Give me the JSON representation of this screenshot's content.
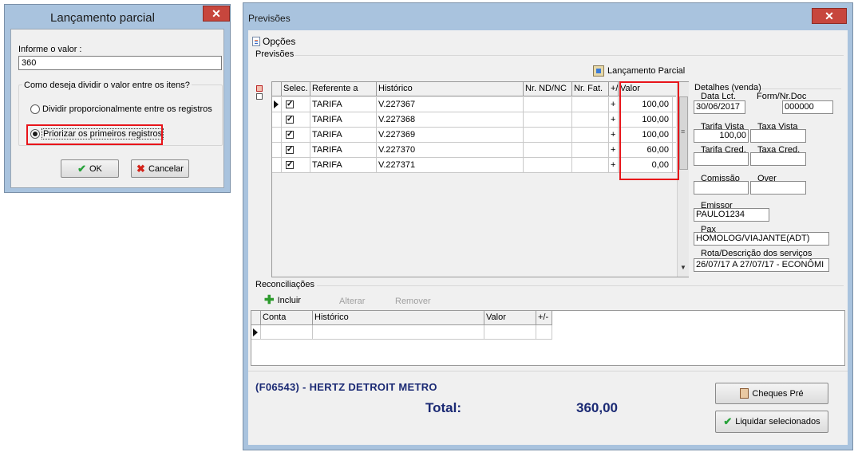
{
  "dialog_partial": {
    "title": "Lançamento parcial",
    "close_glyph": "✕",
    "prompt_label": "Informe o valor :",
    "value": "360",
    "group_label": "Como deseja dividir o valor entre os itens?",
    "option1": "Dividir proporcionalmente entre os registros",
    "option2": "Priorizar os primeiros registros",
    "selected_option": "option2",
    "ok_label": "OK",
    "cancel_label": "Cancelar"
  },
  "window": {
    "title": "Previsões",
    "close_glyph": "✕",
    "opcoes_label": "Opções",
    "previsoes_label": "Previsões",
    "lancamento_parcial_label": "Lançamento Parcial"
  },
  "grid": {
    "headers": {
      "selec": "Selec.",
      "referente": "Referente a",
      "historico": "Histórico",
      "nr_nd": "Nr. ND/NC",
      "nr_fat": "Nr. Fat.",
      "sign": "+/-",
      "valor": "Valor"
    },
    "rows": [
      {
        "checked": "✓",
        "referente": "TARIFA",
        "historico": "V.227367",
        "sign": "+",
        "valor": "100,00"
      },
      {
        "checked": "✓",
        "referente": "TARIFA",
        "historico": "V.227368",
        "sign": "+",
        "valor": "100,00"
      },
      {
        "checked": "✓",
        "referente": "TARIFA",
        "historico": "V.227369",
        "sign": "+",
        "valor": "100,00"
      },
      {
        "checked": "✓",
        "referente": "TARIFA",
        "historico": "V.227370",
        "sign": "+",
        "valor": "60,00"
      },
      {
        "checked": "✓",
        "referente": "TARIFA",
        "historico": "V.227371",
        "sign": "+",
        "valor": "0,00"
      }
    ]
  },
  "details": {
    "section_label": "Detalhes (venda)",
    "data_lct_label": "Data Lct.",
    "data_lct": "30/06/2017",
    "form_nr_doc_label": "Form/Nr.Doc",
    "form_nr_doc": "000000",
    "tarifa_vista_label": "Tarifa Vista",
    "tarifa_vista": "100,00",
    "taxa_vista_label": "Taxa Vista",
    "taxa_vista": "",
    "tarifa_cred_label": "Tarifa Cred.",
    "tarifa_cred": "",
    "taxa_cred_label": "Taxa Cred.",
    "taxa_cred": "",
    "comissao_label": "Comissão",
    "comissao": "",
    "over_label": "Over",
    "over": "",
    "emissor_label": "Emissor",
    "emissor": "PAULO1234",
    "pax_label": "Pax",
    "pax": "HOMOLOG/VIAJANTE(ADT)",
    "rota_label": "Rota/Descrição dos serviços",
    "rota": "26/07/17 A 27/07/17 - ECONÔMI"
  },
  "reconciliacoes": {
    "label": "Reconciliações",
    "incluir": "Incluir",
    "alterar": "Alterar",
    "remover": "Remover",
    "headers": {
      "conta": "Conta",
      "historico": "Histórico",
      "valor": "Valor",
      "sign": "+/-"
    }
  },
  "footer": {
    "company": "(F06543) - HERTZ DETROIT METRO",
    "total_label": "Total:",
    "total_value": "360,00",
    "cheques_label": "Cheques Pré",
    "liquidar_label": "Liquidar selecionados"
  },
  "colors": {
    "highlight": "#e8141a",
    "titlebar": "#a9c3de",
    "footer_text": "#1b2a74"
  }
}
